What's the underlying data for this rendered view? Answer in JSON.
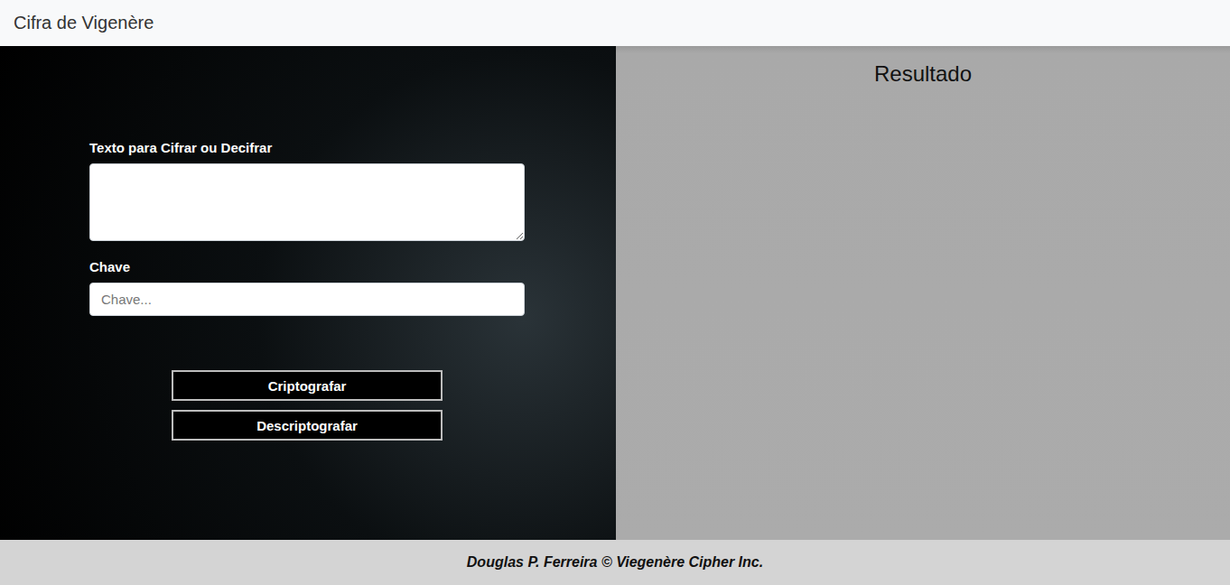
{
  "navbar": {
    "title": "Cifra de Vigenère"
  },
  "form": {
    "text_label": "Texto para Cifrar ou Decifrar",
    "key_label": "Chave",
    "key_placeholder": "Chave..."
  },
  "buttons": [
    "Criptografar",
    "Descriptografar"
  ],
  "result": {
    "title": "Resultado"
  },
  "footer": {
    "text": "Douglas P. Ferreira © Viegenère Cipher Inc."
  }
}
